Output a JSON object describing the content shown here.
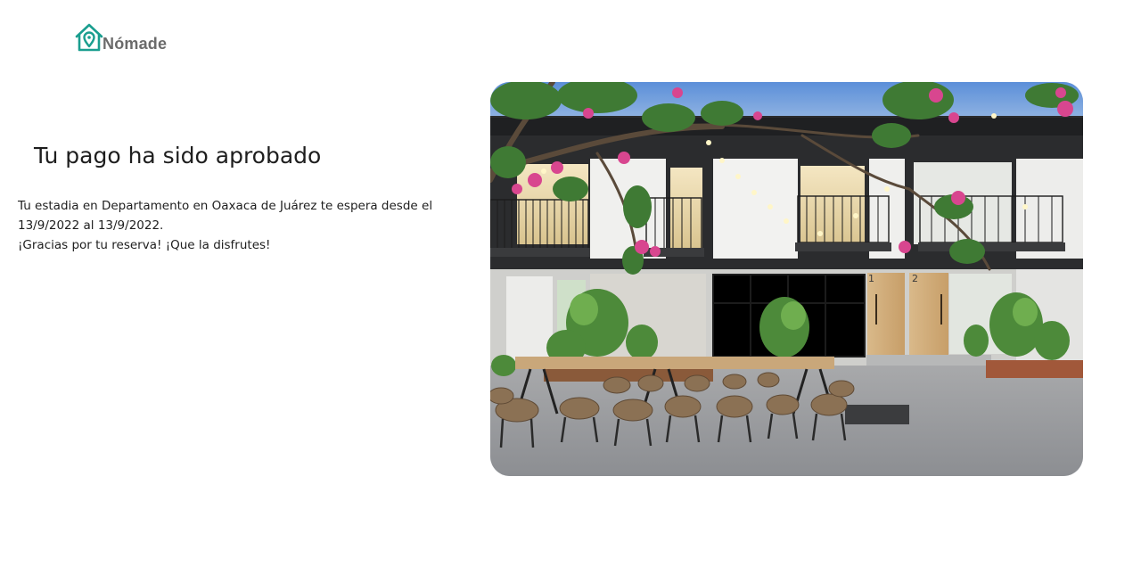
{
  "brand": {
    "name": "Nómade",
    "accent_color": "#1a9e8f",
    "icon": "house-location-pin-icon"
  },
  "confirmation": {
    "title": "Tu pago ha sido aprobado",
    "line1": "Tu estadia en Departamento en Oaxaca de Juárez te espera desde el 13/9/2022 al 13/9/2022.",
    "line2": "¡Gracias por tu reserva! ¡Que la disfrutes!"
  },
  "property_photo": {
    "subject": "courtyard-building-photo",
    "door_numbers": [
      "1",
      "2"
    ]
  }
}
